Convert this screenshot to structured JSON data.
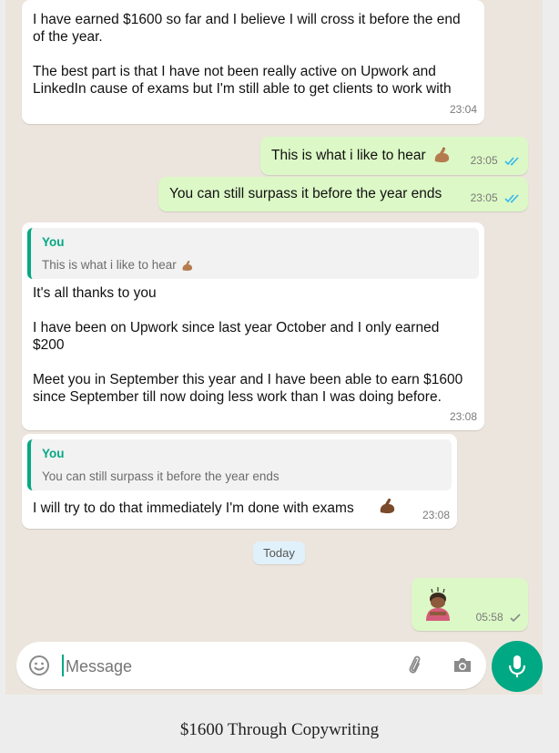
{
  "messages": {
    "m1": {
      "para1": "I have earned $1600 so far and I believe I will cross it before the end of the year.",
      "para2": "The best part is that I have not been really active on Upwork and LinkedIn cause of exams but I'm still able to get clients to work with",
      "time": "23:04"
    },
    "m2": {
      "text": "This is what i like to hear",
      "time": "23:05"
    },
    "m3": {
      "text": "You can still surpass it before the year ends",
      "time": "23:05"
    },
    "m4": {
      "quote_author": "You",
      "quote_text": "This is what i like to hear",
      "para1": "It's all thanks to you",
      "para2": "I have been on Upwork since last year October and I only earned $200",
      "para3": "Meet you in September this year and I have been able to earn $1600 since September till now doing less work than I was doing before.",
      "time": "23:08"
    },
    "m5": {
      "quote_author": "You",
      "quote_text": "You can still surpass it before the year ends",
      "text": "I will try to do that immediately I'm done with exams",
      "time": "23:08"
    },
    "date_separator": "Today",
    "m6": {
      "time": "05:58"
    }
  },
  "composer": {
    "placeholder": "Message"
  },
  "caption": "$1600 Through Copywriting",
  "colors": {
    "accent": "#00a884",
    "outgoing": "#dcf8c6",
    "incoming": "#ffffff",
    "read_tick": "#34b7f1"
  }
}
